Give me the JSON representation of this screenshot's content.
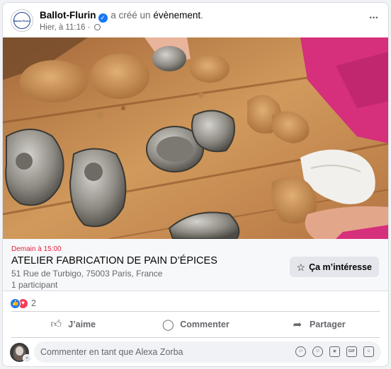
{
  "post": {
    "author": "Ballot-Flurin",
    "avatar_text": "Ballot-Flurin",
    "action_text": "a créé un",
    "action_object": "évènement",
    "timestamp": "Hier, à 11:16",
    "visibility_icon": "globe-icon",
    "more_icon": "more-options-icon",
    "more_label": "···"
  },
  "photo": {
    "content_icon": "gingerbread-molds-photo"
  },
  "event": {
    "date": "Demain à 15:00",
    "title": "ATELIER FABRICATION DE PAIN D’ÉPICES",
    "address": "51 Rue de Turbigo, 75003 Paris, France",
    "participants": "1 participant",
    "interest_button": "Ça m’intéresse",
    "interest_icon": "star-icon"
  },
  "reactions": {
    "count": "2",
    "types": [
      "like",
      "love"
    ]
  },
  "actions": {
    "like": "J’aime",
    "comment": "Commenter",
    "share": "Partager"
  },
  "comment": {
    "placeholder": "Commenter en tant que Alexa Zorba",
    "tools": [
      "avatar-sticker-icon",
      "emoji-icon",
      "camera-icon",
      "gif-icon",
      "sticker-icon"
    ]
  },
  "colors": {
    "accent": "#1877f2",
    "love": "#f33e58",
    "event_date": "#e41e3f",
    "muted": "#65676b"
  }
}
